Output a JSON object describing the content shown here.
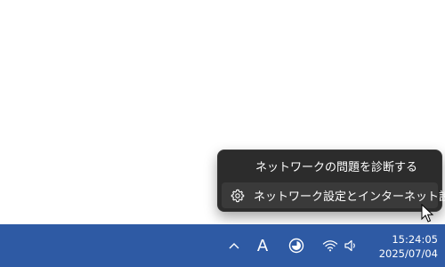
{
  "context_menu": {
    "items": [
      {
        "label": "ネットワークの問題を診断する",
        "icon": null
      },
      {
        "label": "ネットワーク設定とインターネット設定",
        "icon": "gear-icon"
      }
    ]
  },
  "taskbar": {
    "background": "#2e5aa4",
    "tray": {
      "ime_indicator": "A",
      "icons": [
        "chevron-up-icon",
        "ime-icon",
        "focus-icon",
        "wifi-icon",
        "volume-icon"
      ]
    },
    "clock": {
      "time": "15:24:05",
      "date": "2025/07/04"
    }
  }
}
